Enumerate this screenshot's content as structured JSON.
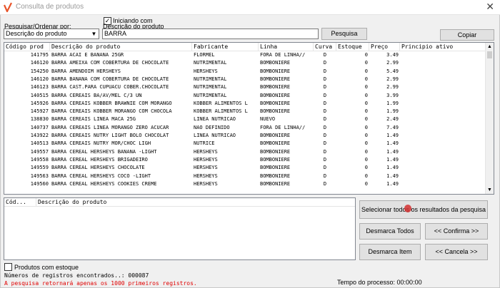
{
  "window": {
    "title": "Consulta de produtos",
    "close": "✕"
  },
  "search": {
    "order_label": "Pesquisar/Ordenar por:",
    "order_value": "Descrição do produto",
    "starts_with_label": "Iniciando com",
    "field_label": "Descrição do produto",
    "query": "BARRA",
    "search_button": "Pesquisa",
    "copy_button": "Copiar"
  },
  "grid": {
    "columns": [
      "Código prod",
      "Descrição do produto",
      "Fabricante",
      "Linha",
      "Curva",
      "Estoque",
      "Preço",
      "Principio ativo"
    ],
    "rows": [
      [
        "141795",
        "BARRA ACAI E BANANA 25GR",
        "FLORMEL",
        "FORA DE LINHA//",
        "D",
        "0",
        "3.49",
        ""
      ],
      [
        "146120",
        "BARRA AMEIXA COM COBERTURA DE CHOCOLATE",
        "NUTRIMENTAL",
        "BOMBONIERE",
        "D",
        "0",
        "2.99",
        ""
      ],
      [
        "154250",
        "BARRA AMENDOIM HERSHEYS",
        "HERSHEYS",
        "BOMBONIERE",
        "D",
        "0",
        "5.49",
        ""
      ],
      [
        "146120",
        "BARRA BANANA COM COBERTURA DE CHOCOLATE",
        "NUTRIMENTAL",
        "BOMBONIERE",
        "D",
        "0",
        "2.99",
        ""
      ],
      [
        "146123",
        "BARRA CAST.PARA CUPUACU COBER.CHOCOLATE",
        "NUTRIMENTAL",
        "BOMBONIERE",
        "D",
        "0",
        "2.99",
        ""
      ],
      [
        "140515",
        "BARRA CEREAIS BA/AV/MEL C/3 UN",
        "NUTRIMENTAL",
        "BOMBONIERE",
        "D",
        "0",
        "3.99",
        ""
      ],
      [
        "145926",
        "BARRA CEREAIS KOBBER BRAWNIE COM MORANGO",
        "KOBBER ALIMENTOS L",
        "BOMBONIERE",
        "D",
        "0",
        "1.99",
        ""
      ],
      [
        "145927",
        "BARRA CEREAIS KOBBER MORANGO COM CHOCOLA",
        "KOBBER ALIMENTOS L",
        "BOMBONIERE",
        "D",
        "0",
        "1.99",
        ""
      ],
      [
        "138830",
        "BARRA CEREAIS LINEA MACA 25G",
        "LINEA NUTRICAO",
        "NUEVO",
        "D",
        "0",
        "2.49",
        ""
      ],
      [
        "140737",
        "BARRA CEREAIS LINEA MORANGO ZERO ACUCAR",
        "NAO DEFINIDO",
        "FORA DE LINHA//",
        "D",
        "0",
        "7.49",
        ""
      ],
      [
        "143922",
        "BARRA CEREAIS NUTRY LIGHT BOLO CHOCOLAT",
        "LINEA NUTRICAO",
        "BOMBONIERE",
        "D",
        "0",
        "1.49",
        ""
      ],
      [
        "140513",
        "BARRA CEREAIS NUTRY MOR/CHOC LIGH",
        "NUTRICE",
        "BOMBONIERE",
        "D",
        "0",
        "1.49",
        ""
      ],
      [
        "149557",
        "BARRA CEREAL HERSHEYS BANANA -LIGHT",
        "HERSHEYS",
        "BOMBONIERE",
        "D",
        "0",
        "1.49",
        ""
      ],
      [
        "149558",
        "BARRA CEREAL HERSHEYS BRIGADEIRO",
        "HERSHEYS",
        "BOMBONIERE",
        "D",
        "0",
        "1.49",
        ""
      ],
      [
        "149559",
        "BARRA CEREAL HERSHEYS CHOCOLATE",
        "HERSHEYS",
        "BOMBONIERE",
        "D",
        "0",
        "1.49",
        ""
      ],
      [
        "149563",
        "BARRA CEREAL HERSHEYS COCO -LIGHT",
        "HERSHEYS",
        "BOMBONIERE",
        "D",
        "0",
        "1.49",
        ""
      ],
      [
        "149560",
        "BARRA CEREAL HERSHEYS COOKIES CREME",
        "HERSHEYS",
        "BOMBONIERE",
        "D",
        "0",
        "1.49",
        ""
      ]
    ]
  },
  "selected": {
    "columns": [
      "Cód...",
      "Descrição do produto"
    ]
  },
  "actions": {
    "select_all": "Selecionar todos os resultados da pesquisa",
    "unmark_all": "Desmarca Todos",
    "confirm": "<< Confirma >>",
    "unmark_item": "Desmarca Item",
    "cancel": "<< Cancela >>"
  },
  "footer": {
    "stock_label": "Produtos com estoque",
    "records": "Números de registros encontrados..: 000087",
    "warning": "A pesquisa retornará apenas os 1000 primeiros registros.",
    "process_time": "Tempo do processo: 00:00:00"
  },
  "colors": {
    "warning": "#e00000",
    "title_text": "#999999",
    "brand_icon": "#e8542a"
  }
}
